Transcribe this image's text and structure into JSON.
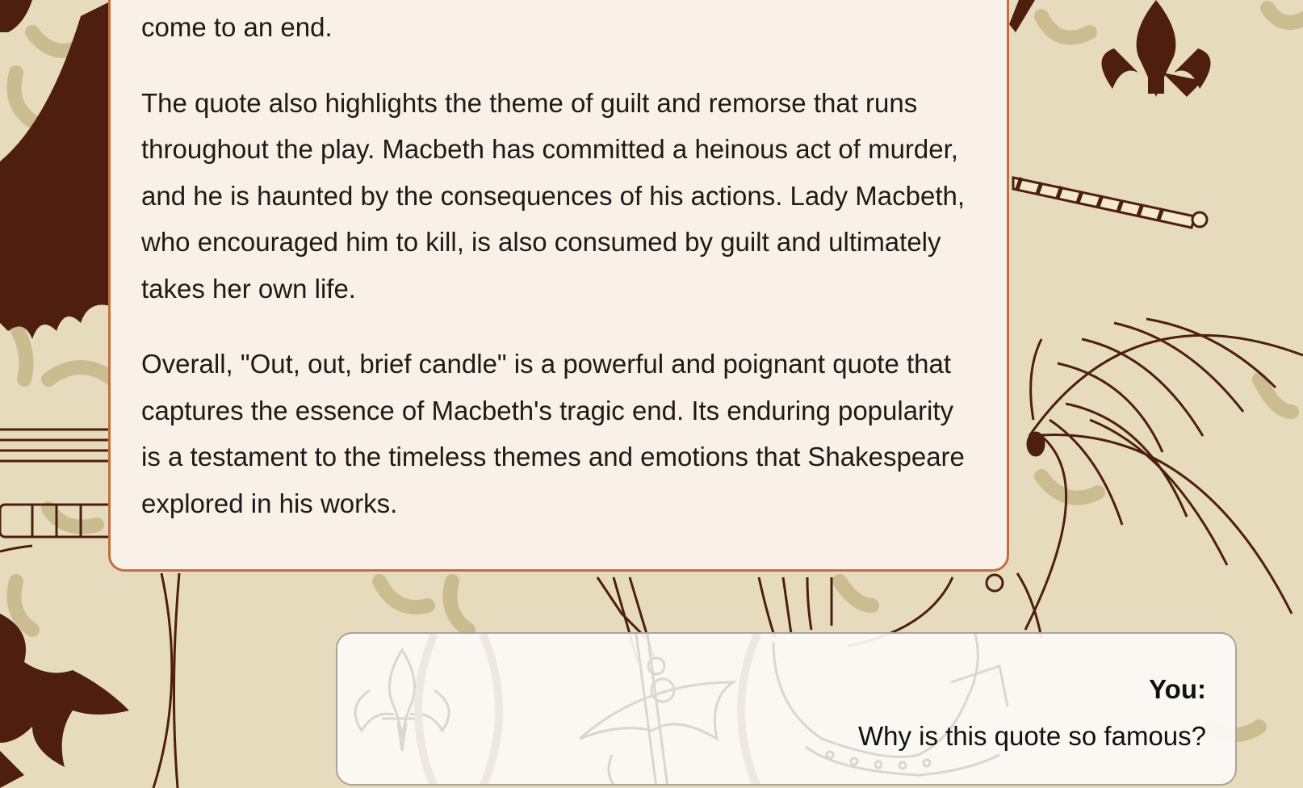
{
  "colors": {
    "background": "#e6dcbd",
    "motif_brown": "#4e1e0f",
    "motif_tan": "#c8b98b",
    "card_background": "#f9f1e8",
    "card_border": "#c46d45"
  },
  "conversation": {
    "assistant_message": {
      "paragraphs": [
        "come to an end.",
        "The quote also highlights the theme of guilt and remorse that runs throughout the play. Macbeth has committed a heinous act of murder, and he is haunted by the consequences of his actions. Lady Macbeth, who encouraged him to kill, is also consumed by guilt and ultimately takes her own life.",
        "Overall, \"Out, out, brief candle\" is a powerful and poignant quote that captures the essence of Macbeth's tragic end. Its enduring popularity is a testament to the timeless themes and emotions that Shakespeare explored in his works."
      ]
    },
    "user_message": {
      "label": "You:",
      "text": "Why is this quote so famous?"
    }
  },
  "decorations": [
    "lion-icon",
    "fleur-de-lis-icon",
    "sword-icon",
    "feather-quill-icon",
    "helmet-icon",
    "rope-icon"
  ]
}
